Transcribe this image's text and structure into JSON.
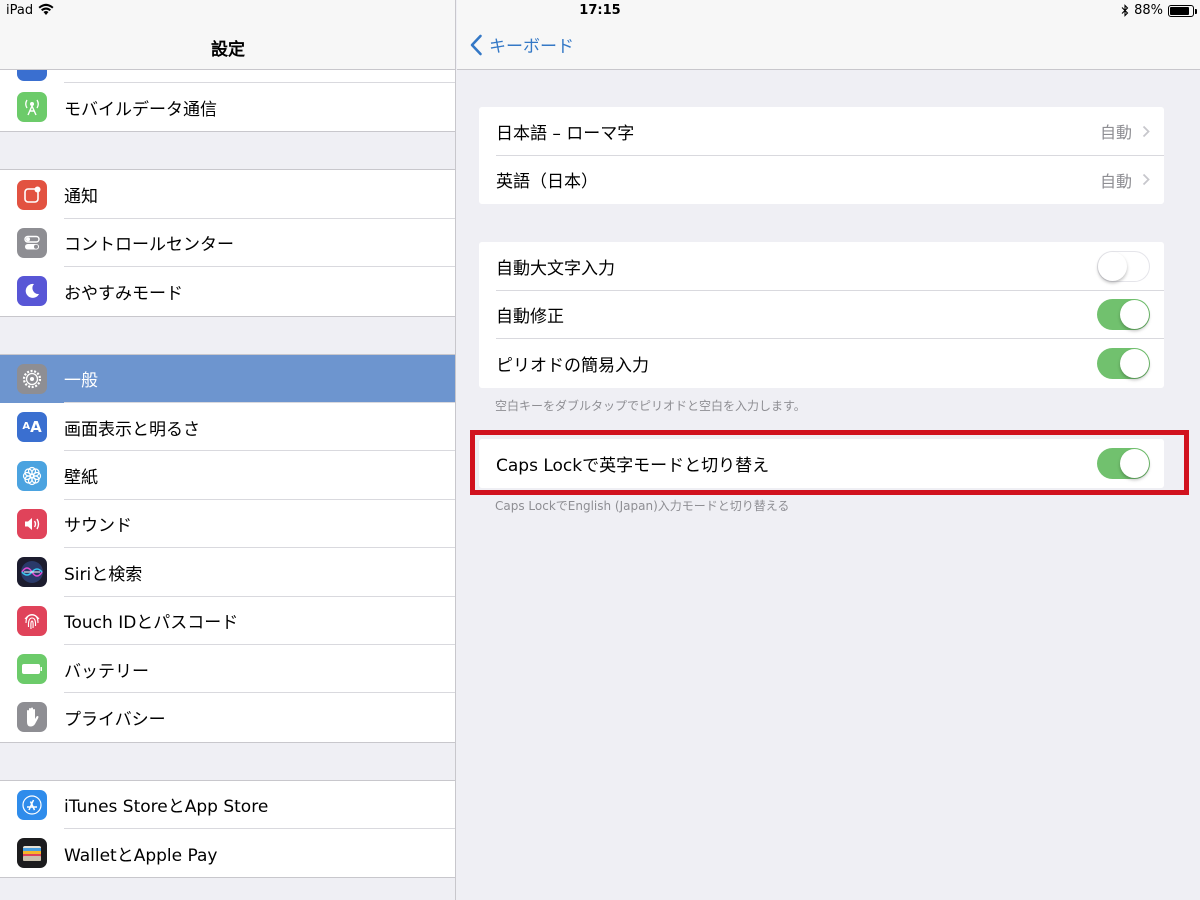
{
  "status_bar": {
    "device": "iPad",
    "time": "17:15",
    "battery_percent": "88%",
    "battery_level": 0.88
  },
  "sidebar": {
    "title": "設定",
    "groups": [
      {
        "items": [
          {
            "label": "モバイルデータ通信",
            "icon": "antenna-icon",
            "color": "#6ccb6a"
          }
        ]
      },
      {
        "items": [
          {
            "label": "通知",
            "icon": "notification-icon",
            "color": "#e25241"
          },
          {
            "label": "コントロールセンター",
            "icon": "toggles-icon",
            "color": "#8e8e93"
          },
          {
            "label": "おやすみモード",
            "icon": "moon-icon",
            "color": "#5856d6"
          }
        ]
      },
      {
        "items": [
          {
            "label": "一般",
            "icon": "gear-icon",
            "color": "#8e8e93",
            "selected": true
          },
          {
            "label": "画面表示と明るさ",
            "icon": "text-size-icon",
            "color": "#3a6fd0"
          },
          {
            "label": "壁紙",
            "icon": "flower-icon",
            "color": "#4ba3e0"
          },
          {
            "label": "サウンド",
            "icon": "speaker-icon",
            "color": "#e0435a"
          },
          {
            "label": "Siriと検索",
            "icon": "siri-icon",
            "color": "#1c1c2e"
          },
          {
            "label": "Touch IDとパスコード",
            "icon": "fingerprint-icon",
            "color": "#e0435a"
          },
          {
            "label": "バッテリー",
            "icon": "battery-icon",
            "color": "#6ccb6a"
          },
          {
            "label": "プライバシー",
            "icon": "hand-icon",
            "color": "#8e8e93"
          }
        ]
      },
      {
        "items": [
          {
            "label": "iTunes StoreとApp Store",
            "icon": "app-store-icon",
            "color": "#2f8ceb"
          },
          {
            "label": "WalletとApple Pay",
            "icon": "wallet-icon",
            "color": "#1c1c1e"
          }
        ]
      }
    ]
  },
  "detail": {
    "back_label": "キーボード",
    "keyboards": [
      {
        "label": "日本語 – ローマ字",
        "value": "自動"
      },
      {
        "label": "英語（日本）",
        "value": "自動"
      }
    ],
    "options": [
      {
        "label": "自動大文字入力",
        "on": false
      },
      {
        "label": "自動修正",
        "on": true
      },
      {
        "label": "ピリオドの簡易入力",
        "on": true
      }
    ],
    "options_footnote": "空白キーをダブルタップでピリオドと空白を入力します。",
    "capslock": {
      "label": "Caps Lockで英字モードと切り替え",
      "on": true
    },
    "capslock_footnote": "Caps LockでEnglish (Japan)入力モードと切り替える",
    "highlight_color": "#d1121e",
    "toggle_on_color": "#71c16e",
    "accent_color": "#3478c6"
  }
}
